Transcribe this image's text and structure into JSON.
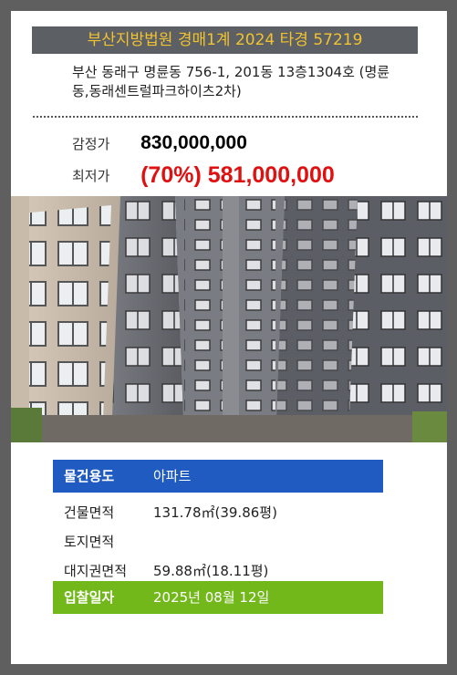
{
  "title": "부산지방법원 경매1계 2024 타경 57219",
  "address": "부산 동래구 명륜동 756-1, 201동 13층1304호 (명륜동,동래센트럴파크하이츠2차)",
  "prices": {
    "appraisal_label": "감정가",
    "appraisal_value": "830,000,000",
    "minimum_label": "최저가",
    "minimum_value": "(70%) 581,000,000"
  },
  "info": [
    {
      "label": "물건용도",
      "value": "아파트"
    },
    {
      "label": "건물면적",
      "value": "131.78㎡(39.86평)"
    },
    {
      "label": "토지면적",
      "value": ""
    },
    {
      "label": "대지권면적",
      "value": "59.88㎡(18.11평)"
    },
    {
      "label": "입찰일자",
      "value": "2025년 08월 12일"
    }
  ],
  "colors": {
    "title_text": "#f2c330",
    "minimum_price": "#e01010",
    "use_row": "#1f5bc0",
    "date_row": "#72b81b"
  }
}
